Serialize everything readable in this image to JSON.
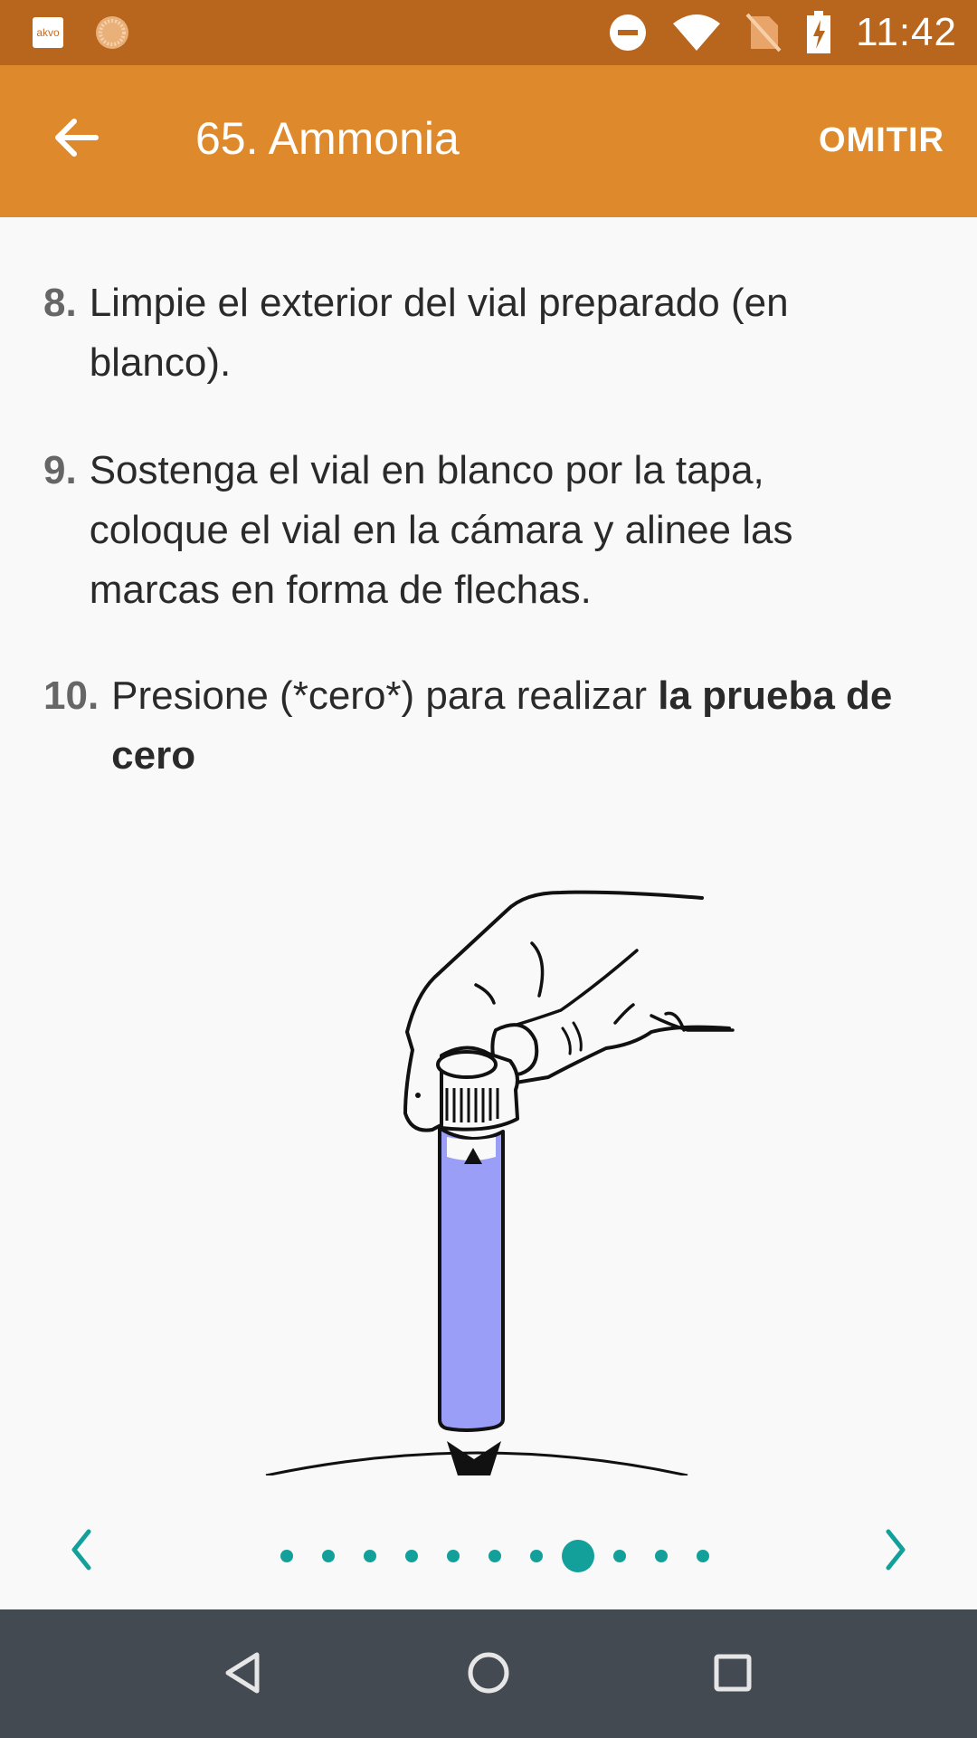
{
  "status_bar": {
    "app_icon_label": "akvo",
    "time": "11:42"
  },
  "app_bar": {
    "title": "65. Ammonia",
    "skip_label": "OMITIR"
  },
  "steps": [
    {
      "number": "8.",
      "text": "Limpie el exterior del vial preparado (en blanco)."
    },
    {
      "number": "9.",
      "text": "Sostenga el vial en blanco por la tapa, coloque el vial en la cámara y alinee las marcas en forma de flechas."
    },
    {
      "number": "10.",
      "text_plain": "Presione (*cero*) para realizar ",
      "text_bold": "la prueba de cero"
    }
  ],
  "pager": {
    "page_count": 11,
    "current_index": 7
  },
  "colors": {
    "status_bar": "#b8651e",
    "app_bar": "#de8a2c",
    "accent": "#13a09b",
    "vial": "#9b9ef7",
    "nav_bar": "#434a52"
  }
}
